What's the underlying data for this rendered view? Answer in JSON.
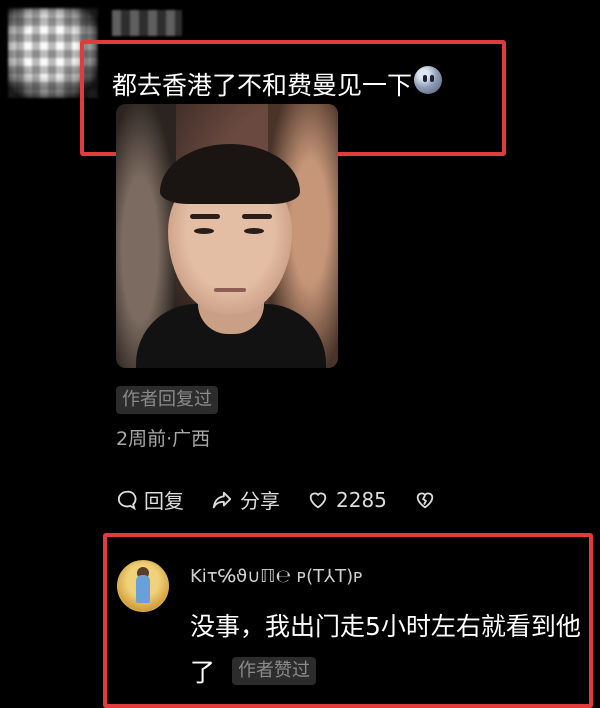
{
  "comment": {
    "text": "都去香港了不和费曼见一下",
    "emoji_icon": "face-emoji-icon",
    "author_badge": "作者回复过",
    "meta": "2周前·广西",
    "actions": {
      "reply_label": "回复",
      "share_label": "分享",
      "like_count": "2285"
    }
  },
  "reply": {
    "username": "Kiτ℅ϑ∪ℿ℮ ᴩ(T⅄T)ᴩ",
    "text_line1": "没事，我出门走5小时左右就看到他",
    "text_line2": "了",
    "author_badge": "作者赞过"
  },
  "colors": {
    "background": "#000000",
    "highlight_box": "#e23b3b",
    "badge_bg": "#2c2c2c",
    "secondary_text": "#a9a9a9"
  }
}
